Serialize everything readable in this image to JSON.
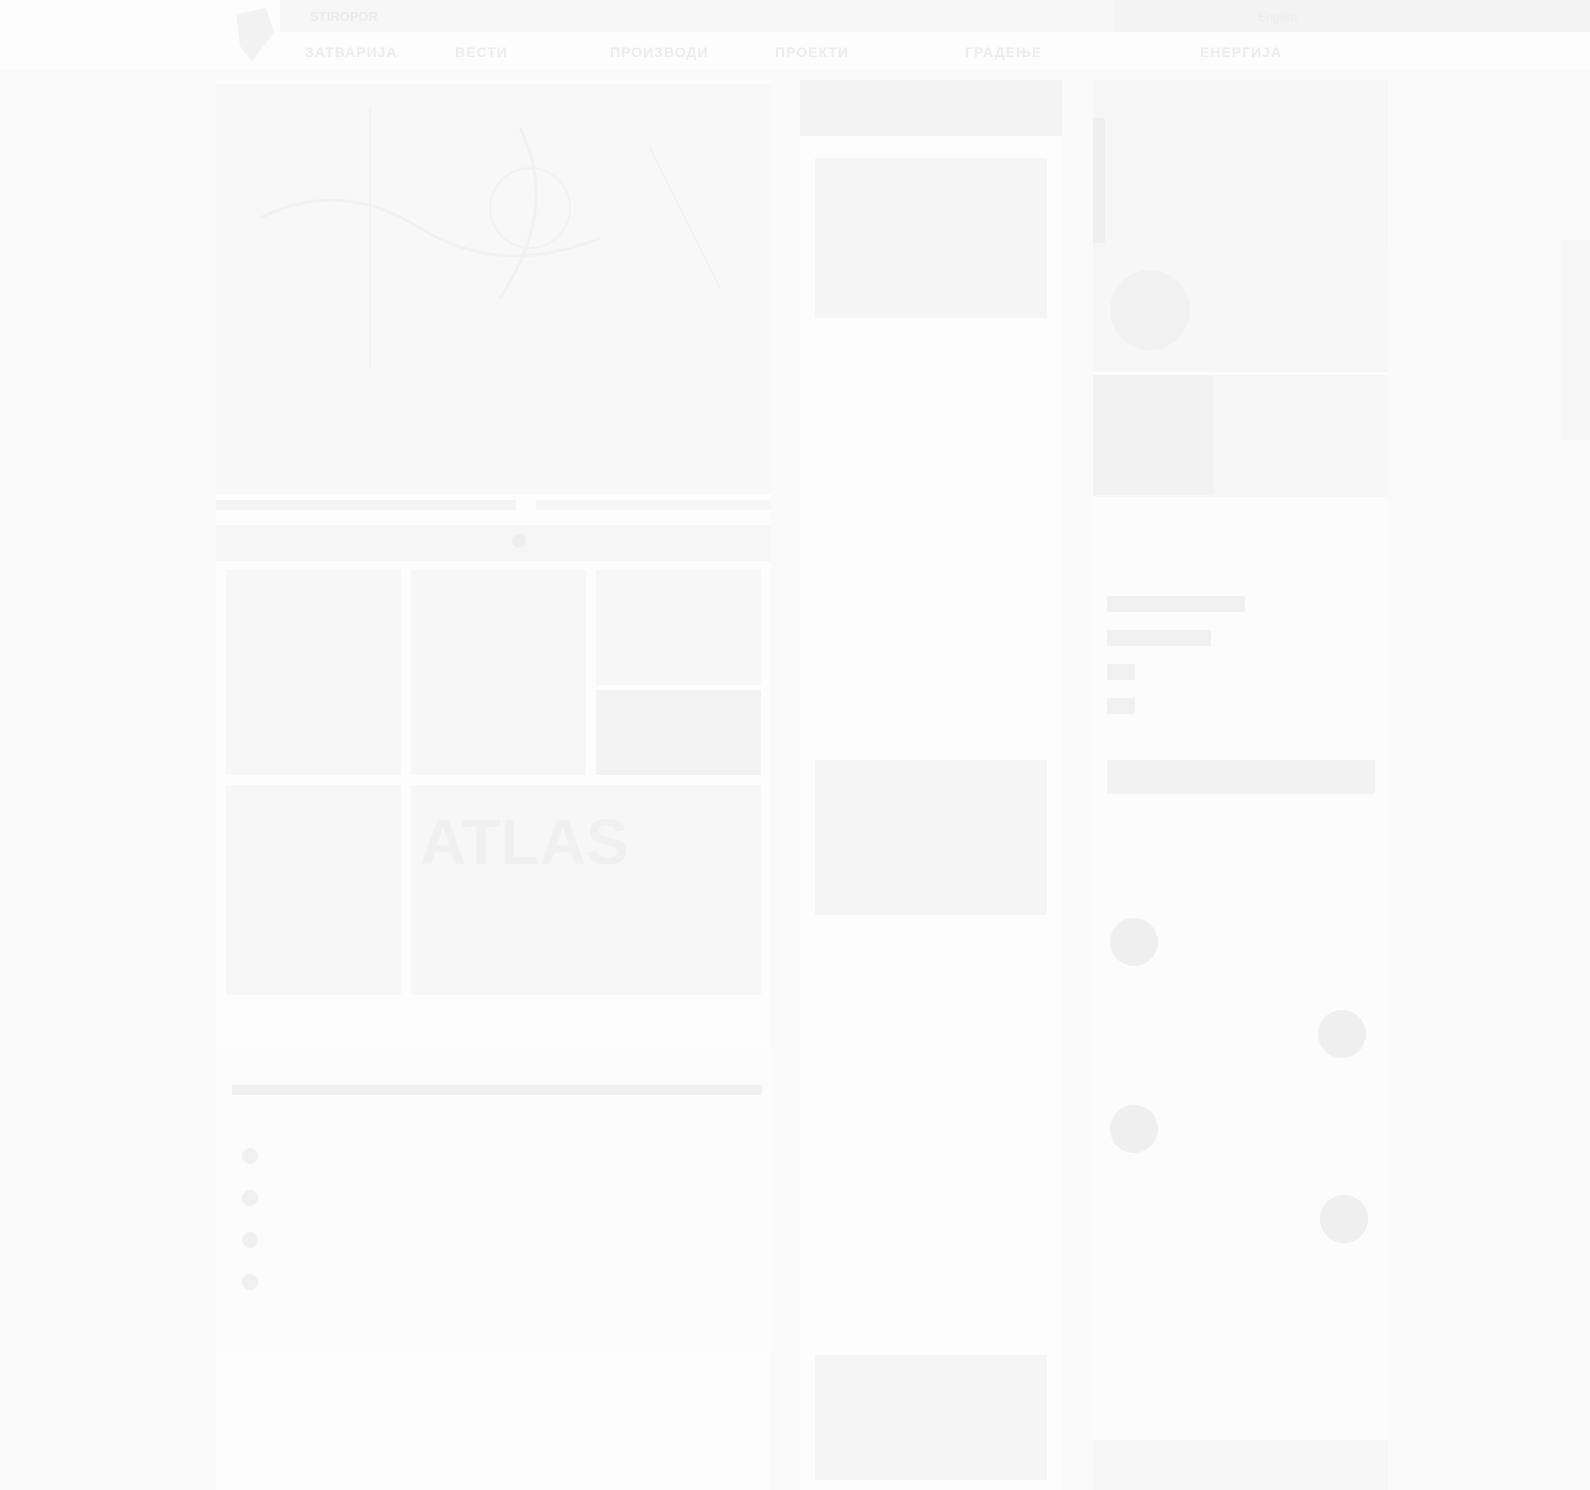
{
  "colors": {
    "page_bg": "#fafafa",
    "panel_bg": "#fdfdfd",
    "faint_text": "#eaeaea",
    "accent": "#f0f0f0"
  },
  "icons": {
    "logo": "brand-logo-icon",
    "sponsor_clock": "clock-icon",
    "blog_bullet": "circle-bullet-icon",
    "consultant": "avatar-icon"
  },
  "header": {
    "ticker": "STIROPOR",
    "lang": "English",
    "nav": [
      "ЗАТВАРИЈА",
      "ВЕСТИ",
      "ПРОИЗВОДИ",
      "ПРОЕКТИ",
      "ГРАДЕЊЕ",
      "ЕНЕРГИЈА"
    ]
  },
  "hero": {
    "meta": "",
    "title": "",
    "lead": ""
  },
  "sponsors": {
    "title": "",
    "subtitle": "",
    "more": "",
    "atlas_label": "ATLAS"
  },
  "blog": {
    "title": "",
    "side_title": "",
    "items": [
      "",
      "",
      "",
      ""
    ],
    "side_items": [
      "",
      "",
      "",
      ""
    ]
  },
  "companies": {
    "title": "",
    "row": ""
  },
  "news": {
    "header": "",
    "items": [
      {
        "title": "",
        "text": ""
      },
      {
        "title": "",
        "text": ""
      },
      {
        "title": "",
        "text": ""
      },
      {
        "title": "",
        "text": ""
      },
      {
        "title": "",
        "text": ""
      },
      {
        "title": "",
        "text": ""
      }
    ]
  },
  "right": {
    "top_text": "",
    "cards": [
      "",
      ""
    ],
    "poll": {
      "title": "",
      "subtitle": "",
      "total": "",
      "results": [
        {
          "label": "",
          "value": 0.6
        },
        {
          "label": "",
          "value": 0.45
        },
        {
          "label": "",
          "value": 0.12
        },
        {
          "label": "",
          "value": 0.12
        }
      ]
    },
    "consult": {
      "title": "",
      "subtitle": "",
      "more": "",
      "items": [
        "",
        "",
        "",
        ""
      ]
    }
  }
}
